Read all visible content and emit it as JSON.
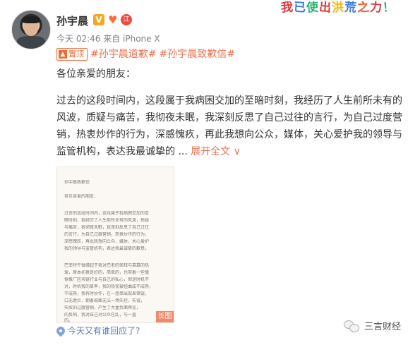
{
  "profile": {
    "name": "孙宇晨",
    "verified_badge": "V",
    "level_badge": "江",
    "post_time": "今天 02:46 来自 iPhone X"
  },
  "sticker": {
    "chars": [
      "我",
      "已",
      "使",
      "出",
      "洪",
      "荒",
      "之",
      "力",
      "！"
    ],
    "colors": [
      "#d73d3d",
      "#3b7dd8",
      "#2bb673",
      "#d73d3d",
      "#f6b600",
      "#3b7dd8",
      "#f05a28",
      "#d73d3d",
      "#2bb673"
    ]
  },
  "post": {
    "pin_label": "置顶",
    "hashtags": [
      "#孙宇晨道歉#",
      "#孙宇晨致歉信#"
    ],
    "greeting": "各位亲爱的朋友：",
    "body_lines": [
      "过去的这段时间内，这段属于我病困交加的至暗时刻，我经历了人生前所未有的",
      "风波，质疑与痛苦，我彻夜未眠，我深刻反思了自己过往的言行，为自己过度营",
      "销，热衷炒作的行为，深感愧疚，再此我想向公众，媒体，关心爱护我的领导与",
      "监管机构，表达我最诚挚的 ..."
    ],
    "expand_link": "展开全文",
    "expand_caret": "∨"
  },
  "image": {
    "title": "孙宇晨致歉信",
    "greeting": "各位亲爱的朋友：",
    "paragraph_1": [
      "过去的这段时间内，这段属于我病困交加的至",
      "暗时刻，我经历了人生前所未有的风波，质疑",
      "与痛苦，我彻夜未眠，我深刻反思了自己过往",
      "的言行，为自己过度营销，热衷炒作的行为，",
      "深感愧疚，再此我想向公众，媒体，关心爱护",
      "我的领导与监管机构，表达我最诚挚的歉意。"
    ],
    "paragraph_2": [
      "巴菲特午餐缘起于我对巴老的崇拜与慕慕的热",
      "爱，原本初衷是好的，简单的，也带着一些憧",
      "憬推广区块链行业与自己的私心，但是时机不",
      "对，时机我的草率，我的热忱被扭曲成不成熟，",
      "不成熟，我有时炒作，在一连串出现差错误，",
      "口无遮拦，朝着局面无法一场失控，失误，",
      "失败的过度营销，产生了大量负面舆论，",
      "的反响，我对自己对公众在乱，与一直",
      "的。"
    ],
    "long_image_tag": "长图"
  },
  "location": {
    "text": "今天又有谁回应了?"
  },
  "watermark": {
    "text": "三言财经"
  },
  "colors": {
    "accent": "#eb7350",
    "pin": "#f46a35",
    "link": "#5c7ea8",
    "text": "#333333",
    "muted": "#808080"
  }
}
